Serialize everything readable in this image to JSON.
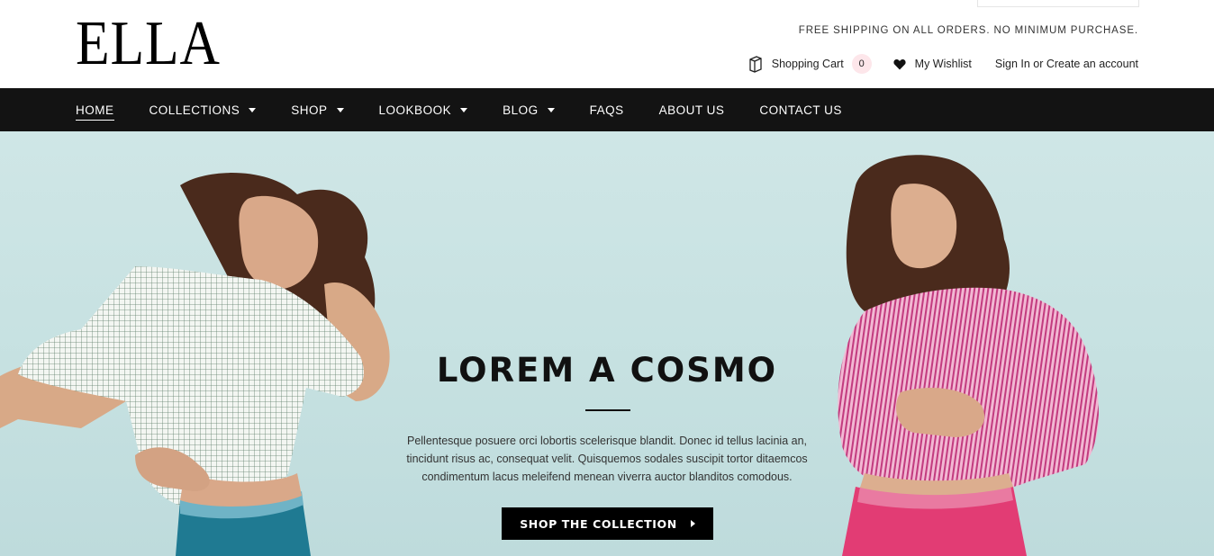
{
  "header": {
    "logo": "ELLA",
    "promo": "FREE SHIPPING ON ALL ORDERS. NO MINIMUM PURCHASE.",
    "cart_label": "Shopping Cart",
    "cart_count": "0",
    "wishlist_label": "My Wishlist",
    "account_label": "Sign In or Create an account"
  },
  "nav": {
    "items": [
      {
        "label": "HOME",
        "dropdown": false,
        "active": true
      },
      {
        "label": "COLLECTIONS",
        "dropdown": true
      },
      {
        "label": "SHOP",
        "dropdown": true
      },
      {
        "label": "LOOKBOOK",
        "dropdown": true
      },
      {
        "label": "BLOG",
        "dropdown": true
      },
      {
        "label": "FAQS",
        "dropdown": false
      },
      {
        "label": "ABOUT US",
        "dropdown": false
      },
      {
        "label": "CONTACT US",
        "dropdown": false
      }
    ]
  },
  "hero": {
    "title": "LOREM A COSMO",
    "text_line1": "Pellentesque posuere orci lobortis scelerisque blandit. Donec id tellus lacinia an,",
    "text_line2": "tincidunt risus ac, consequat velit. Quisquemos sodales suscipit tortor ditaemcos",
    "text_line3": "condimentum lacus meleifend menean viverra auctor blanditos comodous.",
    "button_label": "SHOP THE COLLECTION"
  },
  "colors": {
    "nav_bg": "#131313",
    "hero_bg": "#c6e1e1",
    "cart_badge": "#fde6ea",
    "button_bg": "#000000"
  },
  "icons": [
    "cart-icon",
    "heart-icon",
    "caret-down-icon",
    "arrow-right-icon"
  ]
}
